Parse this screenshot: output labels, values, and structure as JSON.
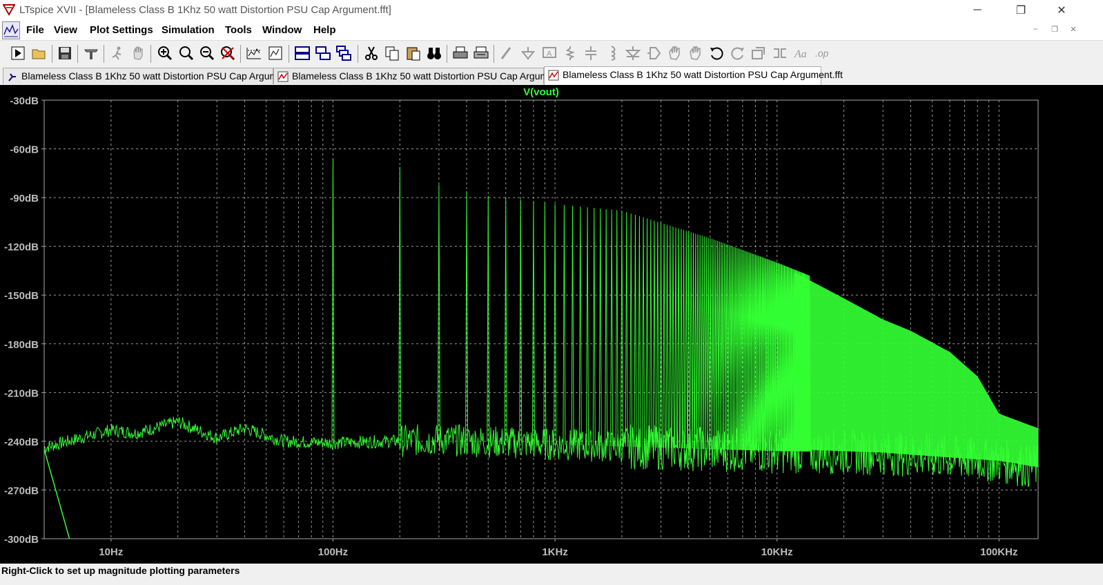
{
  "window": {
    "title": "LTspice XVII - [Blameless Class B 1Khz 50 watt Distortion PSU Cap Argument.fft]",
    "minimize_glyph": "─",
    "restore_glyph": "❐",
    "close_glyph": "✕"
  },
  "menu": {
    "items": [
      {
        "label": "File"
      },
      {
        "label": "View"
      },
      {
        "label": "Plot Settings"
      },
      {
        "label": "Simulation"
      },
      {
        "label": "Tools"
      },
      {
        "label": "Window"
      },
      {
        "label": "Help"
      }
    ],
    "mdi_minimize": "–",
    "mdi_restore": "❐",
    "mdi_close": "✕"
  },
  "toolbar": {
    "icons": [
      "open-schematic",
      "open-file",
      "save",
      "control-panel",
      "run",
      "halt",
      "zoom-in",
      "zoom-pan",
      "zoom-out",
      "zoom-full",
      "autorange",
      "plot-pane",
      "tile-horizontal",
      "tile-vertical",
      "cascade",
      "cut",
      "copy",
      "paste",
      "find",
      "print",
      "print-preview",
      "wire",
      "ground",
      "label",
      "resistor",
      "capacitor",
      "inductor",
      "diode",
      "component",
      "move",
      "drag",
      "undo",
      "redo",
      "rotate",
      "mirror",
      "text",
      "spice-directive"
    ]
  },
  "tabs": [
    {
      "label": "Blameless Class B 1Khz 50 watt Distortion PSU Cap Argument",
      "icon": "schematic-icon"
    },
    {
      "label": "Blameless Class B 1Khz 50 watt Distortion PSU Cap Argument",
      "icon": "waveform-icon"
    },
    {
      "label": "Blameless Class B 1Khz 50 watt Distortion PSU Cap Argument.fft",
      "icon": "waveform-icon",
      "active": true
    }
  ],
  "status": {
    "text": "Right-Click to set up magnitude plotting parameters"
  },
  "colors": {
    "trace": "#33ff33",
    "grid": "#9a9a9a",
    "axis_text": "#bdbdbd",
    "plot_bg": "#000000"
  },
  "chart_data": {
    "type": "line",
    "title": "V(vout)",
    "xlabel": "",
    "ylabel": "",
    "x_scale": "log",
    "xlim": [
      5,
      150000
    ],
    "ylim": [
      -300,
      -30
    ],
    "x_ticks": [
      {
        "value": 10,
        "label": "10Hz"
      },
      {
        "value": 100,
        "label": "100Hz"
      },
      {
        "value": 1000,
        "label": "1KHz"
      },
      {
        "value": 10000,
        "label": "10KHz"
      },
      {
        "value": 100000,
        "label": "100KHz"
      }
    ],
    "y_ticks": [
      {
        "value": -30,
        "label": "-30dB"
      },
      {
        "value": -60,
        "label": "-60dB"
      },
      {
        "value": -90,
        "label": "-90dB"
      },
      {
        "value": -120,
        "label": "-120dB"
      },
      {
        "value": -150,
        "label": "-150dB"
      },
      {
        "value": -180,
        "label": "-180dB"
      },
      {
        "value": -210,
        "label": "-210dB"
      },
      {
        "value": -240,
        "label": "-240dB"
      },
      {
        "value": -270,
        "label": "-270dB"
      },
      {
        "value": -300,
        "label": "-300dB"
      }
    ],
    "grid": true,
    "series": [
      {
        "name": "V(vout)",
        "noise_floor": [
          [
            5,
            -244
          ],
          [
            10,
            -233
          ],
          [
            13,
            -235
          ],
          [
            20,
            -228
          ],
          [
            30,
            -238
          ],
          [
            40,
            -232
          ],
          [
            60,
            -240
          ],
          [
            100,
            -241
          ],
          [
            300,
            -239
          ],
          [
            1000,
            -242
          ],
          [
            3000,
            -244
          ],
          [
            10000,
            -246
          ],
          [
            30000,
            -247
          ],
          [
            100000,
            -252
          ],
          [
            150000,
            -256
          ]
        ],
        "low_end_drop": [
          [
            5,
            -245
          ],
          [
            6.5,
            -300
          ]
        ],
        "harmonics": [
          [
            100,
            -66
          ],
          [
            200,
            -71
          ],
          [
            300,
            -82
          ],
          [
            400,
            -86
          ],
          [
            500,
            -89
          ],
          [
            600,
            -90
          ],
          [
            700,
            -91
          ],
          [
            800,
            -92
          ],
          [
            900,
            -93
          ],
          [
            1000,
            -94
          ]
        ],
        "harmonic_spacing_hz": 100,
        "harmonic_envelope": [
          [
            1000,
            -94
          ],
          [
            2000,
            -98
          ],
          [
            5000,
            -115
          ],
          [
            10000,
            -130
          ],
          [
            14000,
            -138
          ],
          [
            20000,
            -152
          ],
          [
            30000,
            -165
          ],
          [
            40000,
            -172
          ],
          [
            60000,
            -185
          ],
          [
            80000,
            -200
          ],
          [
            100000,
            -223
          ],
          [
            150000,
            -232
          ]
        ],
        "fill_upper": [
          [
            12000,
            -136
          ],
          [
            20000,
            -152
          ],
          [
            30000,
            -165
          ],
          [
            40000,
            -172
          ],
          [
            60000,
            -185
          ],
          [
            80000,
            -200
          ],
          [
            100000,
            -223
          ],
          [
            150000,
            -232
          ]
        ],
        "fill_lower": [
          [
            12000,
            -245
          ],
          [
            30000,
            -247
          ],
          [
            60000,
            -250
          ],
          [
            100000,
            -252
          ],
          [
            150000,
            -256
          ]
        ]
      }
    ]
  }
}
